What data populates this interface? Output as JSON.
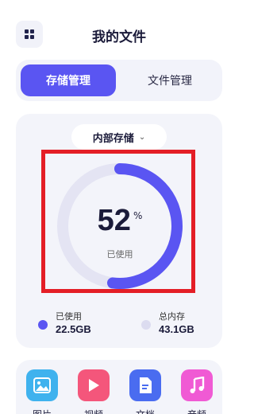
{
  "header": {
    "title": "我的文件",
    "menu_icon": "grid-menu-icon"
  },
  "tabs": [
    {
      "label": "存储管理",
      "active": true
    },
    {
      "label": "文件管理",
      "active": false
    }
  ],
  "storage": {
    "selector_label": "内部存储",
    "percent": "52",
    "percent_sign": "%",
    "percent_label": "已使用",
    "used_fraction": 0.52,
    "used": {
      "label": "已使用",
      "value": "22.5GB"
    },
    "total": {
      "label": "总内存",
      "value": "43.1GB"
    }
  },
  "categories": [
    {
      "label": "图片",
      "icon": "image-icon",
      "color": "#3fb2ee"
    },
    {
      "label": "视频",
      "icon": "play-icon",
      "color": "#f4567b"
    },
    {
      "label": "文档",
      "icon": "document-icon",
      "color": "#4a6cf0"
    },
    {
      "label": "音频",
      "icon": "music-note-icon",
      "color": "#f05ad4"
    }
  ],
  "colors": {
    "accent": "#5a55f2",
    "ring_track": "#e4e4f3",
    "legend_used": "#5a55f2",
    "legend_total": "#dcdcf0",
    "highlight": "#e41e26"
  }
}
